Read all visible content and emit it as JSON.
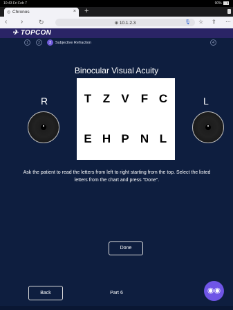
{
  "status_bar": {
    "time_date": "10:43  Fri Feb 7",
    "battery": "90%"
  },
  "browser": {
    "tab_title": "Chronos",
    "new_tab_symbol": "+",
    "url": "10.1.2.3",
    "icons": [
      "back-icon",
      "forward-icon",
      "reload-icon",
      "lock-icon",
      "mic-icon",
      "bookmark-star-icon",
      "share-icon",
      "more-icon"
    ]
  },
  "app": {
    "brand": "TOPCON"
  },
  "steps": {
    "items": [
      "1",
      "2",
      "3",
      "4"
    ],
    "active_index": 2,
    "active_label": "Subjective Refraction"
  },
  "test": {
    "title": "Binocular Visual Acuity",
    "rows": [
      [
        "T",
        "Z",
        "V",
        "F",
        "C"
      ],
      [
        "E",
        "H",
        "P",
        "N",
        "L"
      ]
    ],
    "right_eye_label": "R",
    "left_eye_label": "L",
    "instruction": "Ask the patient to read the letters from left to right starting from the top. Select the listed letters from the chart and press \"Done\"."
  },
  "actions": {
    "done_label": "Done",
    "back_label": "Back",
    "part_label": "Part 6"
  },
  "colors": {
    "background": "#0e1e3f",
    "header": "#2a2466",
    "accent": "#6f5bd9",
    "assist_button": "#6f55e6"
  }
}
